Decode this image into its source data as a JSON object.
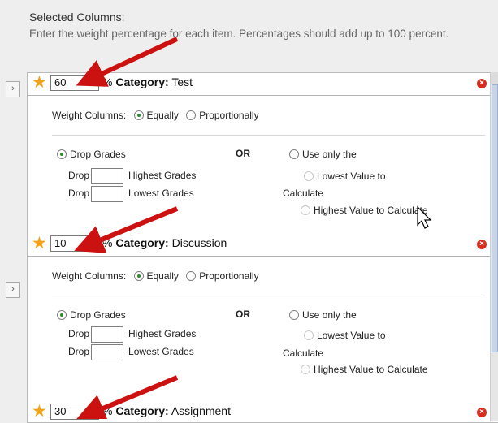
{
  "header": {
    "title": "Selected Columns:",
    "instructions": "Enter the weight percentage for each item. Percentages should add up to 100 percent."
  },
  "labels": {
    "pct_prefix": "% ",
    "category_label": "Category:",
    "weight_columns": "Weight Columns:",
    "equally": "Equally",
    "proportionally": "Proportionally",
    "drop_grades": "Drop Grades",
    "or": "OR",
    "use_only": "Use only the",
    "drop": "Drop",
    "highest_grades": "Highest Grades",
    "lowest_grades": "Lowest Grades",
    "lowest_value_to": "Lowest Value to",
    "calculate": "Calculate",
    "highest_value_to_calculate": "Highest Value to Calculate"
  },
  "categories": [
    {
      "weight": "60",
      "name": "Test"
    },
    {
      "weight": "10",
      "name": "Discussion"
    },
    {
      "weight": "30",
      "name": "Assignment"
    }
  ],
  "icons": {
    "required": "star-icon",
    "remove": "remove-icon",
    "expand": "expand-icon",
    "annotation": "red-arrow-icon"
  },
  "colors": {
    "required_star": "#f2a31b",
    "remove_button": "#d92a1c",
    "radio_selected": "#2e8b2e",
    "annotation_arrow": "#cc1111"
  }
}
